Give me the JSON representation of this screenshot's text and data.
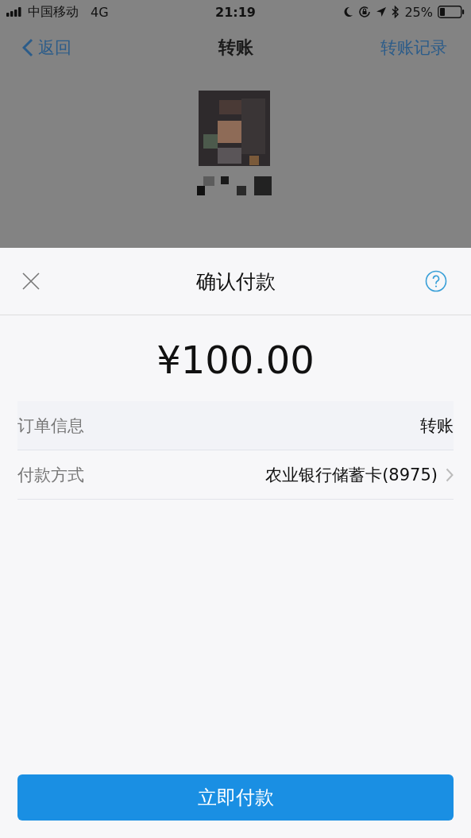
{
  "status_bar": {
    "carrier": "中国移动",
    "network": "4G",
    "time": "21:19",
    "battery": "25%"
  },
  "nav_bar": {
    "back": "返回",
    "title": "转账",
    "action": "转账记录"
  },
  "sheet": {
    "title": "确认付款",
    "amount": "¥100.00",
    "rows": [
      {
        "kind": "info",
        "label": "订单信息",
        "value": "转账"
      },
      {
        "kind": "link",
        "label": "付款方式",
        "value": "农业银行储蓄卡(8975)"
      }
    ],
    "button": "立即付款"
  }
}
